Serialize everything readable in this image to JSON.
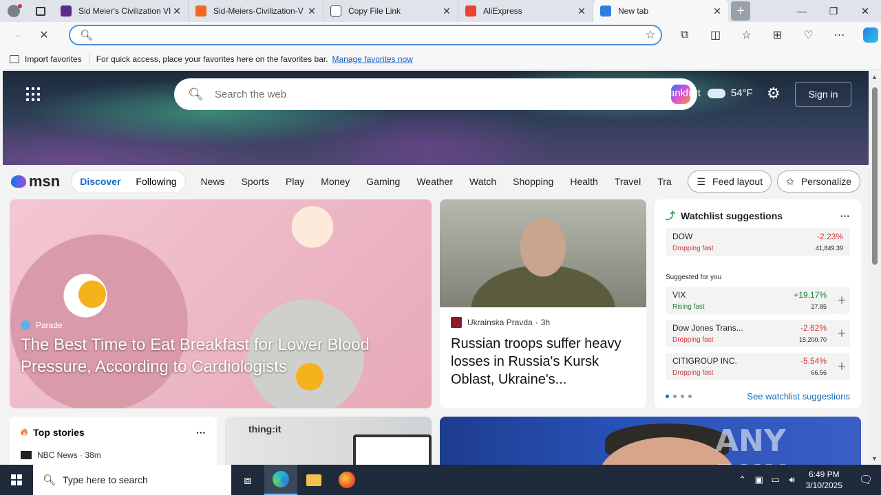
{
  "browser": {
    "tabs": [
      {
        "label": "Sid Meier's Civilization VI",
        "favicon_color": "#5b2a86",
        "active": false
      },
      {
        "label": "Sid-Meiers-Civilization-V",
        "favicon_color": "#f26522",
        "active": false
      },
      {
        "label": "Copy File Link",
        "favicon_color": "#ffffff",
        "active": false
      },
      {
        "label": "AliExpress",
        "favicon_color": "#e8452c",
        "active": false
      },
      {
        "label": "New tab",
        "favicon_color": "#2d7de0",
        "active": true
      }
    ],
    "address": {
      "value": "",
      "placeholder": ""
    },
    "favorites_bar": {
      "import_label": "Import favorites",
      "message": "For quick access, place your favorites here on the favorites bar.",
      "manage_link": "Manage favorites now"
    }
  },
  "newtab": {
    "search": {
      "placeholder": "Search the web"
    },
    "weather": {
      "location": "ankfurt",
      "temp": "54°F"
    },
    "sign_in": "Sign in",
    "brand": "msn",
    "feed_tabs": [
      {
        "label": "Discover",
        "selected": true
      },
      {
        "label": "Following",
        "selected": false
      }
    ],
    "categories": [
      "News",
      "Sports",
      "Play",
      "Money",
      "Gaming",
      "Weather",
      "Watch",
      "Shopping",
      "Health",
      "Travel",
      "Tra"
    ],
    "feed_layout": "Feed layout",
    "personalize": "Personalize",
    "hero_story": {
      "source": "Parade",
      "title": "The Best Time to Eat Breakfast for Lower Blood Pressure, According to Cardiologists"
    },
    "side_story": {
      "source": "Ukrainska Pravda",
      "age": "3h",
      "title": "Russian troops suffer heavy losses in Russia's Kursk Oblast, Ukraine's..."
    },
    "watchlist": {
      "title": "Watchlist suggestions",
      "primary": {
        "name": "DOW",
        "status": "Dropping fast",
        "change": "-2.23%",
        "value": "41,849.39",
        "direction": "down"
      },
      "suggested_label": "Suggested for you",
      "suggested": [
        {
          "name": "VIX",
          "status": "Rising fast",
          "change": "+19.17%",
          "value": "27.85",
          "direction": "up"
        },
        {
          "name": "Dow Jones Trans...",
          "status": "Dropping fast",
          "change": "-2.62%",
          "value": "15,200.70",
          "direction": "down"
        },
        {
          "name": "CITIGROUP INC.",
          "status": "Dropping fast",
          "change": "-5.54%",
          "value": "66.56",
          "direction": "down"
        }
      ],
      "see_more": "See watchlist suggestions"
    },
    "top_stories": {
      "title": "Top stories",
      "first_source": "NBC News · 38m"
    },
    "promo_brand": "thing:it",
    "watermark": "ANY RUN"
  },
  "taskbar": {
    "search_placeholder": "Type here to search",
    "time": "6:49 PM",
    "date": "3/10/2025"
  },
  "colors": {
    "accent": "#0f6cbd",
    "negative": "#d13438",
    "positive": "#1a7f37",
    "taskbar": "#1f2a3a"
  }
}
